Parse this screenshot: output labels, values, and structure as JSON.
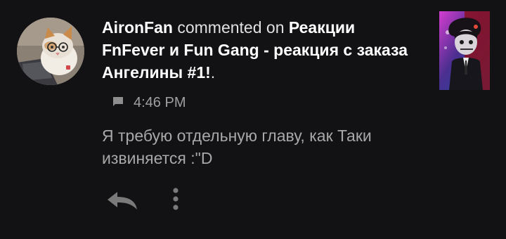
{
  "notification": {
    "user": "AironFan",
    "action": "commented on",
    "video_title": "Реакции FnFever и Fun Gang - реакция с заказа Ангелины #1!",
    "trailing": ".",
    "time": "4:46 PM",
    "comment": "Я требую отдельную главу, как Таки извиняется :\"D"
  },
  "icons": {
    "meta": "comment-icon",
    "reply": "reply-icon",
    "more": "more-vertical-icon"
  },
  "colors": {
    "background": "#121113",
    "primary_text": "#ffffff",
    "secondary_text": "#a8a8a8"
  }
}
